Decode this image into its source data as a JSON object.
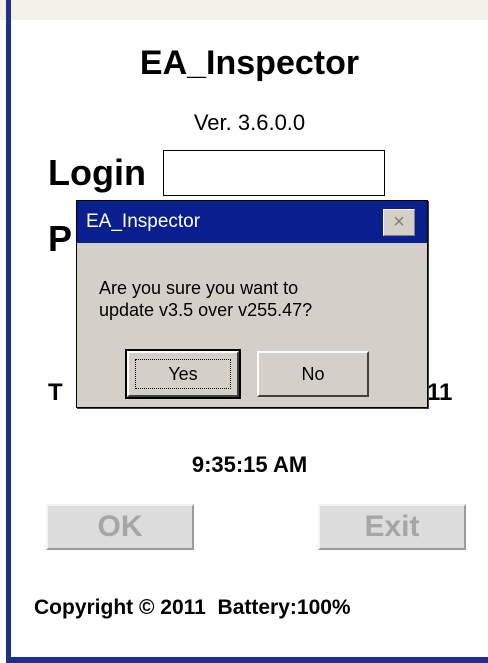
{
  "app": {
    "title": "EA_Inspector",
    "version": "Ver. 3.6.0.0"
  },
  "login": {
    "label": "Login",
    "value": ""
  },
  "password": {
    "label_visible": "P"
  },
  "datetime": {
    "date_left_fragment": "T",
    "date_right_fragment": "11",
    "time": "9:35:15 AM"
  },
  "buttons": {
    "ok_label": "OK",
    "exit_label": "Exit"
  },
  "footer": {
    "copyright": "Copyright © 2011",
    "battery": "Battery:100%"
  },
  "dialog": {
    "title": "EA_Inspector",
    "close_icon": "×",
    "message_line1": "Are you sure you want to",
    "message_line2": "update v3.5 over v255.47?",
    "yes_label": "Yes",
    "no_label": "No"
  },
  "colors": {
    "title_bar": "#0a1f8f",
    "dialog_bg": "#d4d0c8",
    "disabled_text": "#a6a6a6",
    "frame_border": "#1f2f8f"
  }
}
